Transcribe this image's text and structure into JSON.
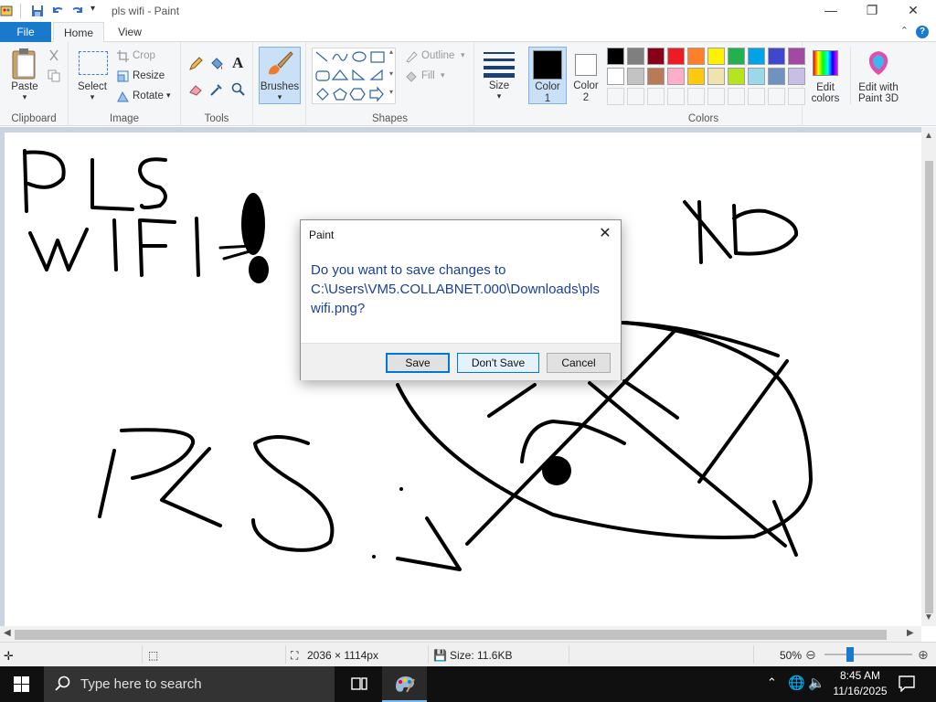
{
  "window": {
    "title": "pls wifi - Paint",
    "minimize": "—",
    "maximize": "❐",
    "close": "✕"
  },
  "tabs": {
    "file": "File",
    "home": "Home",
    "view": "View",
    "help": "?"
  },
  "ribbon": {
    "clipboard": {
      "label": "Clipboard",
      "paste": "Paste"
    },
    "image": {
      "label": "Image",
      "select": "Select",
      "crop": "Crop",
      "resize": "Resize",
      "rotate": "Rotate"
    },
    "tools": {
      "label": "Tools"
    },
    "brushes": {
      "label": "Brushes"
    },
    "shapes": {
      "label": "Shapes",
      "outline": "Outline",
      "fill": "Fill"
    },
    "size": {
      "label": "Size"
    },
    "color1": {
      "label1": "Color",
      "label2": "1"
    },
    "color2": {
      "label1": "Color",
      "label2": "2"
    },
    "colors": {
      "label": "Colors",
      "row1": [
        "#000000",
        "#7f7f7f",
        "#880015",
        "#ed1c24",
        "#ff7f27",
        "#fff200",
        "#22b14c",
        "#00a2e8",
        "#3f48cc",
        "#a349a4"
      ],
      "row2": [
        "#ffffff",
        "#c3c3c3",
        "#b97a57",
        "#ffaec9",
        "#ffc90e",
        "#efe4b0",
        "#b5e61d",
        "#99d9ea",
        "#7092be",
        "#c8bfe7"
      ]
    },
    "edit_colors": {
      "label1": "Edit",
      "label2": "colors"
    },
    "paint3d": {
      "label1": "Edit with",
      "label2": "Paint 3D"
    }
  },
  "canvas": {
    "texts": [
      "PLS",
      "WIFI",
      "XD",
      "PLS"
    ]
  },
  "status": {
    "dimensions": "2036 × 1114px",
    "size": "Size: 11.6KB",
    "zoom": "50%",
    "zoom_level": 0.5
  },
  "dialog": {
    "title": "Paint",
    "message": "Do you want to save changes to C:\\Users\\VM5.COLLABNET.000\\Downloads\\pls wifi.png?",
    "save": "Save",
    "dont_save": "Don't Save",
    "cancel": "Cancel"
  },
  "taskbar": {
    "search_placeholder": "Type here to search",
    "time": "8:45 AM",
    "date": "11/16/2025"
  }
}
